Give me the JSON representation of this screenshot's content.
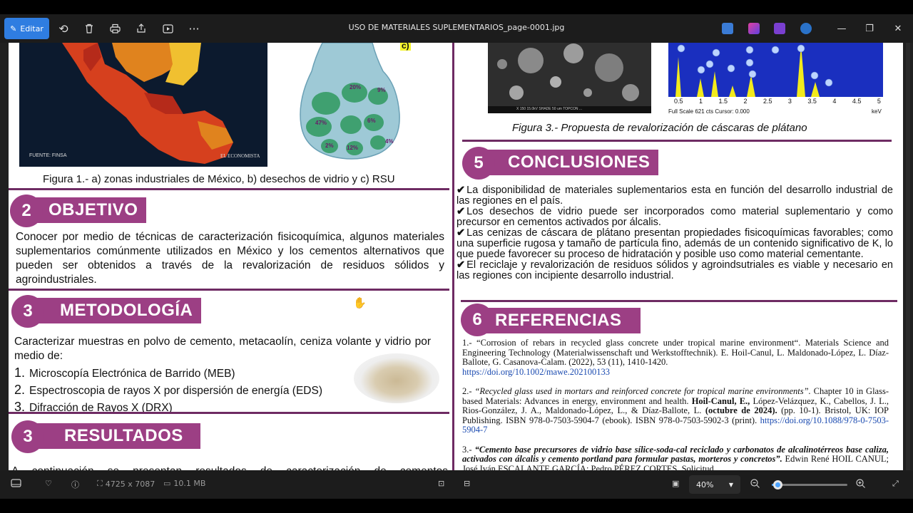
{
  "toolbar": {
    "edit_label": "Editar",
    "file_title": "USO DE MATERIALES SUPLEMENTARIOS_page-0001.jpg",
    "icons": [
      "rotate-icon",
      "delete-icon",
      "print-icon",
      "share-icon",
      "slideshow-icon",
      "more-icon"
    ]
  },
  "poster": {
    "fig1_source": "FUENTE: FINSA",
    "fig1_brand": "EL ECONOMISTA",
    "fig1_label_c": "c)",
    "bag_pcts": [
      "20%",
      "9%",
      "47%",
      "6%",
      "2%",
      "12%",
      "4%"
    ],
    "fig1_caption": "Figura 1.- a) zonas industriales de México, b) desechos de vidrio y c) RSU",
    "objetivo_num": "2",
    "objetivo_title": "OBJETIVO",
    "objetivo_text": "Conocer por medio de técnicas de caracterización fisicoquímica, algunos materiales suplementarios comúnmente utilizados en México y los cementos alternativos que pueden ser obtenidos a través de la revalorización de residuos sólidos y agroindustriales.",
    "metodologia_num": "3",
    "metodologia_title": "METODOLOGÍA",
    "metodologia_text": "Caracterizar muestras en polvo de cemento, metacaolín, ceniza volante y vidrio por medio de:",
    "methods": [
      {
        "n": "1.",
        "text": "Microscopía Electrónica de Barrido (MEB)"
      },
      {
        "n": "2.",
        "text": "Espectroscopia de rayos X por dispersión de energía (EDS)"
      },
      {
        "n": "3.",
        "text": "Difracción de Rayos X (DRX)"
      }
    ],
    "resultados_num": "3",
    "resultados_title": "RESULTADOS",
    "resultados_text": "A continuación se presentan resultados de caracterización de cementos",
    "sem_caption": "X 150    15.0kV SHADE    50 um    TOPCON ...",
    "eds_ticks": [
      "0.5",
      "1",
      "1.5",
      "2",
      "2.5",
      "3",
      "3.5",
      "4",
      "4.5",
      "5"
    ],
    "eds_footer": "Full Scale 621 cts Cursor: 0.000",
    "eds_unit": "keV",
    "fig3_caption": "Figura 3.- Propuesta de revalorización de cáscaras de plátano",
    "conclusiones_num": "5",
    "conclusiones_title": "CONCLUSIONES",
    "conclusiones": [
      "La disponibilidad  de materiales suplementarios esta en función del desarrollo industrial de las regiones en el país.",
      "Los desechos de vidrio puede ser incorporados como material suplementario y como precursor en cementos activados por álcalis.",
      "Las cenizas de cáscara de plátano presentan propiedades fisicoquímicas favorables; como una superficie rugosa y tamaño de partícula fino, además de un contenido significativo de K, lo  que puede favorecer su proceso de hidratación y posible uso como material cementante.",
      "El reciclaje y revalorización de residuos sólidos y agroindsutriales es viable y necesario en las regiones con incipiente desarrollo industrial."
    ],
    "referencias_num": "6",
    "referencias_title": "REFERENCIAS",
    "ref1_text": "1.- “Corrosion of rebars in recycled glass concrete under tropical marine environment“. Materials Science and Engineering Technology (Materialwissenschaft und Werkstofftechnik). E. Hoil-Canul, L. Maldonado-López, L. Díaz-Ballote, G. Casanova-Calam. (2022), 53 (11), 1410-1420.",
    "ref1_link": "https://doi.org/10.1002/mawe.202100133",
    "ref2_prefix": "2.- ",
    "ref2_title": "“Recycled glass used in mortars and reinforced concrete for tropical marine environments”.",
    "ref2_mid": " Chapter 10 in Glass-based Materials: Advances in energy, environment and health. ",
    "ref2_author": "Hoil-Canul, E.,",
    "ref2_rest": " López-Velázquez, K., Cabellos, J. L., Rios-González, J. A., Maldonado-López, L., & Díaz-Ballote, L. ",
    "ref2_date": "(octubre de 2024).",
    "ref2_tail": " (pp. 10-1). Bristol, UK: IOP Publishing. ISBN 978-0-7503-5904-7 (ebook). ISBN 978-0-7503-5902-3 (print). ",
    "ref2_link": "https://doi.org/10.1088/978-0-7503-5904-7",
    "ref3_prefix": "3.- ",
    "ref3_title": "“Cemento base precursores de vidrio base sílice-soda-cal reciclado y carbonatos de alcalinotérreos base caliza, activados con álcalis y cemento portland para formular pastas, morteros y concretos”.",
    "ref3_rest": " Edwin René HOIL CANUL; José Iván ESCALANTE GARCÍA; Pedro PÉREZ CORTES. Solicitud"
  },
  "statusbar": {
    "dimensions": "4725 x 7087",
    "filesize": "10.1 MB",
    "zoom": "40%",
    "zoom_slider_fraction": 0.08
  }
}
